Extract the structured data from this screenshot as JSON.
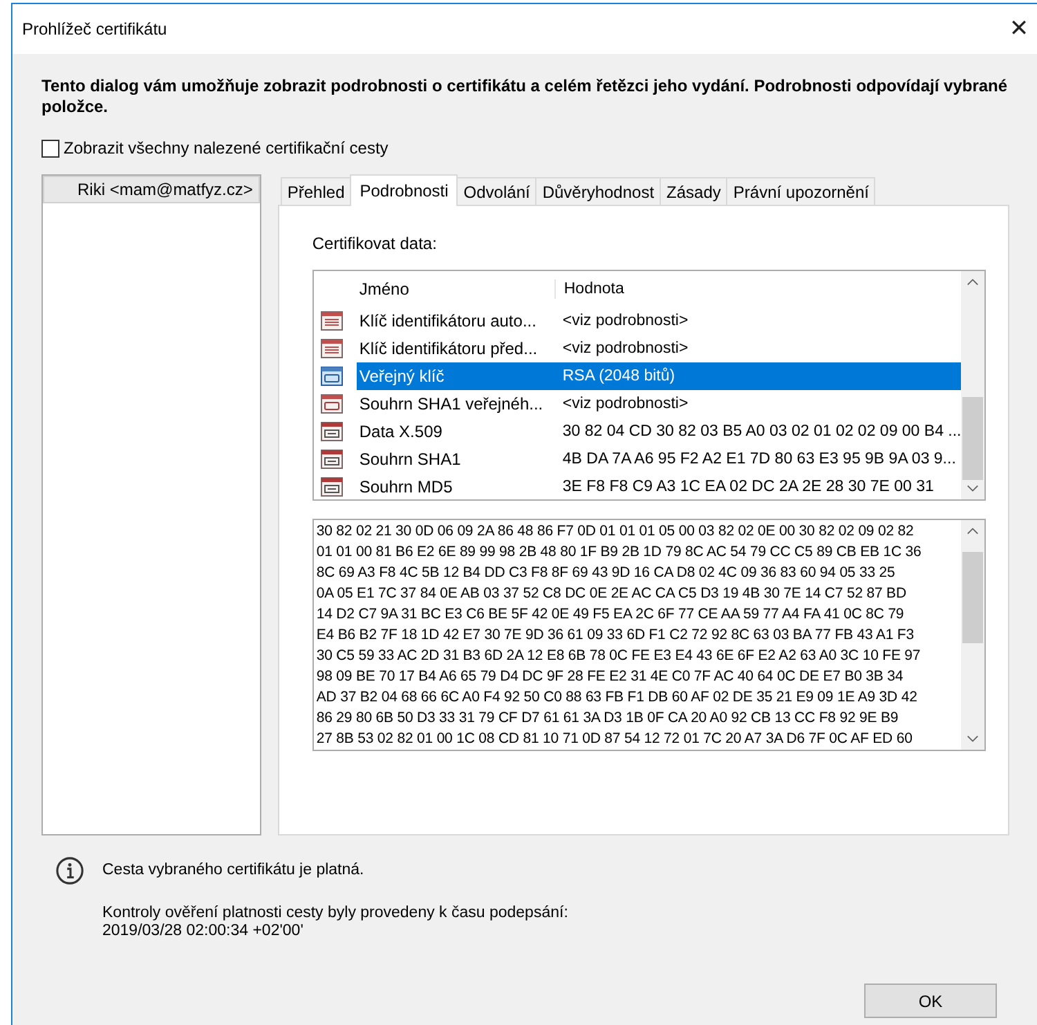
{
  "window": {
    "title": "Prohlížeč certifikátu",
    "close": "✕"
  },
  "intro": "Tento dialog vám umožňuje zobrazit podrobnosti o certifikátu a celém řetězci jeho vydání. Podrobnosti odpovídají vybrané položce.",
  "show_all_paths": {
    "label": "Zobrazit všechny nalezené certifikační cesty",
    "checked": false
  },
  "chain": [
    {
      "label": "Riki <mam@matfyz.cz>",
      "selected": true
    }
  ],
  "tabs": [
    {
      "label": "Přehled",
      "selected": false
    },
    {
      "label": "Podrobnosti",
      "selected": true
    },
    {
      "label": "Odvolání",
      "selected": false
    },
    {
      "label": "Důvěryhodnost",
      "selected": false
    },
    {
      "label": "Zásady",
      "selected": false
    },
    {
      "label": "Právní upozornění",
      "selected": false
    }
  ],
  "details": {
    "label": "Certifikovat data:",
    "columns": [
      "Jméno",
      "Hodnota"
    ],
    "rows": [
      {
        "kind": "extension",
        "name": "Klíč identifikátoru auto...",
        "value": "<viz podrobnosti>",
        "selected": false
      },
      {
        "kind": "extension",
        "name": "Klíč identifikátoru před...",
        "value": "<viz podrobnosti>",
        "selected": false
      },
      {
        "kind": "key",
        "name": "Veřejný klíč",
        "value": "RSA (2048 bitů)",
        "selected": true
      },
      {
        "kind": "key",
        "name": "Souhrn SHA1 veřejnéh...",
        "value": "<viz podrobnosti>",
        "selected": false
      },
      {
        "kind": "data",
        "name": "Data X.509",
        "value": "30 82 04 CD 30 82 03 B5 A0 03 02 01 02 02 09 00 B4 ...",
        "selected": false
      },
      {
        "kind": "data",
        "name": "Souhrn SHA1",
        "value": "4B DA 7A A6 95 F2 A2 E1 7D 80 63 E3 95 9B 9A 03 9...",
        "selected": false
      },
      {
        "kind": "data",
        "name": "Souhrn MD5",
        "value": "3E F8 F8 C9 A3 1C EA 02 DC 2A 2E 28 30 7E 00 31",
        "selected": false
      }
    ],
    "hex": [
      "30 82 02 21 30 0D 06 09 2A 86 48 86 F7 0D 01 01 01 05 00 03 82 02 0E 00 30 82 02 09 02 82",
      "01 01 00 81 B6 E2 6E 89 99 98 2B 48 80 1F B9 2B 1D 79 8C AC 54 79 CC C5 89 CB EB 1C 36",
      "8C 69 A3 F8 4C 5B 12 B4 DD C3 F8 8F 69 43 9D 16 CA D8 02 4C 09 36 83 60 94 05 33 25",
      "0A 05 E1 7C 37 84 0E AB 03 37 52 C8 DC 0E 2E AC CA C5 D3 19 4B 30 7E 14 C7 52 87 BD",
      "14 D2 C7 9A 31 BC E3 C6 BE 5F 42 0E 49 F5 EA 2C 6F 77 CE AA 59 77 A4 FA 41 0C 8C 79",
      "E4 B6 B2 7F 18 1D 42 E7 30 7E 9D 36 61 09 33 6D F1 C2 72 92 8C 63 03 BA 77 FB 43 A1 F3",
      "30 C5 59 33 AC 2D 31 B3 6D 2A 12 E8 6B 78 0C FE E3 E4 43 6E 6F E2 A2 63 A0 3C 10 FE 97",
      "98 09 BE 70 17 B4 A6 65 79 D4 DC 9F 28 FE E2 31 4E C0 7F AC 40 64 0C DE E7 B0 3B 34",
      "AD 37 B2 04 68 66 6C A0 F4 92 50 C0 88 63 FB F1 DB 60 AF 02 DE 35 21 E9 09 1E A9 3D 42",
      "86 29 80 6B 50 D3 33 31 79 CF D7 61 61 3A D3 1B 0F CA 20 A0 92 CB 13 CC F8 92 9E B9",
      "27 8B 53 02 82 01 00 1C 08 CD 81 10 71 0D 87 54 12 72 01 7C 20 A7 3A D6 7F 0C AF ED 60"
    ]
  },
  "status": {
    "message": "Cesta vybraného certifikátu je platná.",
    "note": "Kontroly ověření platnosti cesty byly provedeny k času podepsání:",
    "timestamp": "2019/03/28 02:00:34 +02'00'"
  },
  "buttons": [
    "OK"
  ]
}
